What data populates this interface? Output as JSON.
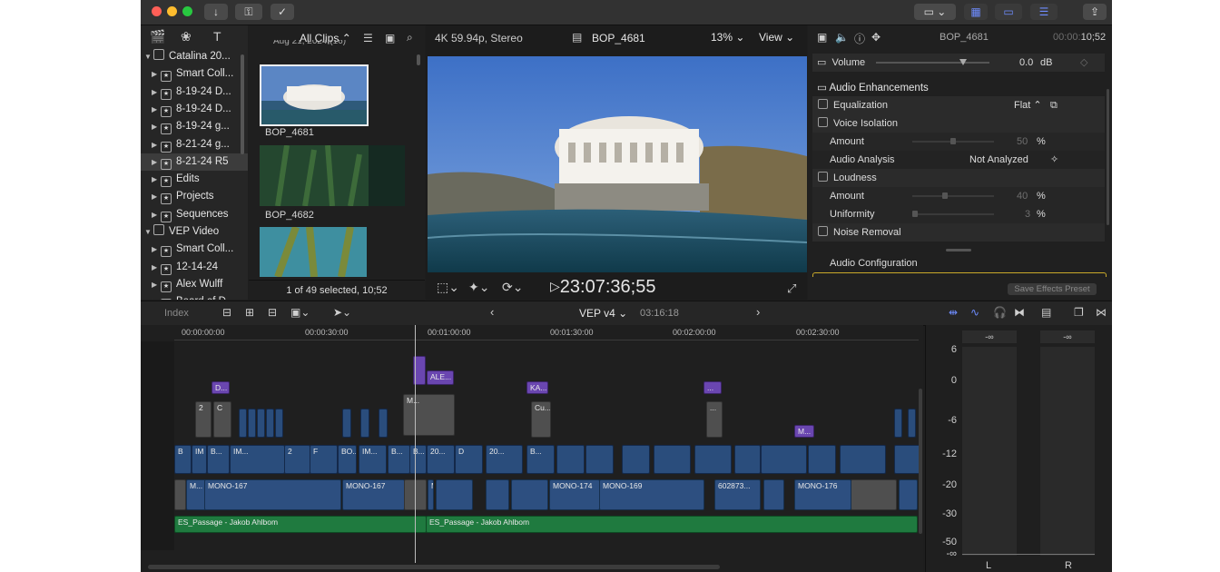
{
  "toolbar": {
    "import_icon": "download-arrow",
    "keywords_icon": "key",
    "check_icon": "checkmark"
  },
  "browser": {
    "filter": "All Clips",
    "cropped_date": "Aug 21, 2024  (16)",
    "library_items": [
      {
        "label": "Catalina 20...",
        "level": 0,
        "open": true
      },
      {
        "label": "Smart Coll...",
        "level": 1
      },
      {
        "label": "8-19-24 D...",
        "level": 1
      },
      {
        "label": "8-19-24 D...",
        "level": 1
      },
      {
        "label": "8-19-24 g...",
        "level": 1
      },
      {
        "label": "8-21-24 g...",
        "level": 1
      },
      {
        "label": "8-21-24 R5",
        "level": 1,
        "selected": true
      },
      {
        "label": "Edits",
        "level": 1
      },
      {
        "label": "Projects",
        "level": 1
      },
      {
        "label": "Sequences",
        "level": 1
      },
      {
        "label": "VEP Video",
        "level": 0,
        "open": true
      },
      {
        "label": "Smart Coll...",
        "level": 1
      },
      {
        "label": "12-14-24",
        "level": 1
      },
      {
        "label": "Alex Wulff",
        "level": 1
      },
      {
        "label": "Board of D...",
        "level": 1
      }
    ],
    "clips": [
      {
        "name": "BOP_4681"
      },
      {
        "name": "BOP_4682"
      }
    ],
    "status": "1 of 49 selected, 10;52"
  },
  "viewer": {
    "format": "4K 59.94p, Stereo",
    "clip_name": "BOP_4681",
    "zoom": "13%",
    "view_label": "View",
    "timecode": "23:07:36;55"
  },
  "inspector": {
    "clip_name": "BOP_4681",
    "duration_dim": "00:00:",
    "duration": "10;52",
    "volume_label": "Volume",
    "volume_value": "0.0",
    "volume_unit": "dB",
    "volume_level": 0.76,
    "enhancements_title": "Audio Enhancements",
    "equalization_label": "Equalization",
    "equalization_value": "Flat",
    "voice_isolation_label": "Voice Isolation",
    "amount_label": "Amount",
    "voice_amount": "50",
    "voice_amount_frac": 0.5,
    "analysis_label": "Audio Analysis",
    "analysis_value": "Not Analyzed",
    "loudness_label": "Loudness",
    "loudness_amount": "40",
    "loudness_amount_frac": 0.4,
    "uniformity_label": "Uniformity",
    "uniformity_value": "3",
    "uniformity_frac": 0.03,
    "percent": "%",
    "noise_label": "Noise Removal",
    "config_title": "Audio Configuration",
    "save_preset": "Save Effects Preset"
  },
  "timeline": {
    "index_label": "Index",
    "project": "VEP v4",
    "duration": "03:16:18",
    "ruler": [
      "00:00:00:00",
      "00:00:30:00",
      "00:01:00:00",
      "00:01:30:00",
      "00:02:00:00",
      "00:02:30:00"
    ],
    "connected_labels": [
      "D...",
      "ALE...",
      "KA...",
      "...",
      "M..."
    ],
    "title_labels": [
      "2",
      "C",
      "M...",
      "Cu...",
      "..."
    ],
    "primary_labels": [
      "B",
      "IM",
      "B...",
      "IM...",
      "2",
      "F",
      "BO...",
      "IM...",
      "B...",
      "B...",
      "20...",
      "D",
      "20...",
      "B..."
    ],
    "audio_labels": [
      "M...",
      "MONO-167",
      "MONO-167",
      "M...",
      "MONO-174",
      "MONO-169",
      "602873...",
      "M...",
      "MONO-176"
    ],
    "music_labels": [
      "ES_Passage - Jakob Ahlbom",
      "ES_Passage - Jakob Ahlbom"
    ]
  },
  "meters": {
    "scale": [
      "6",
      "0",
      "-6",
      "-12",
      "-20",
      "-30",
      "-50",
      "-∞"
    ],
    "peak_l": "-∞",
    "peak_r": "-∞",
    "channel_l": "L",
    "channel_r": "R"
  }
}
